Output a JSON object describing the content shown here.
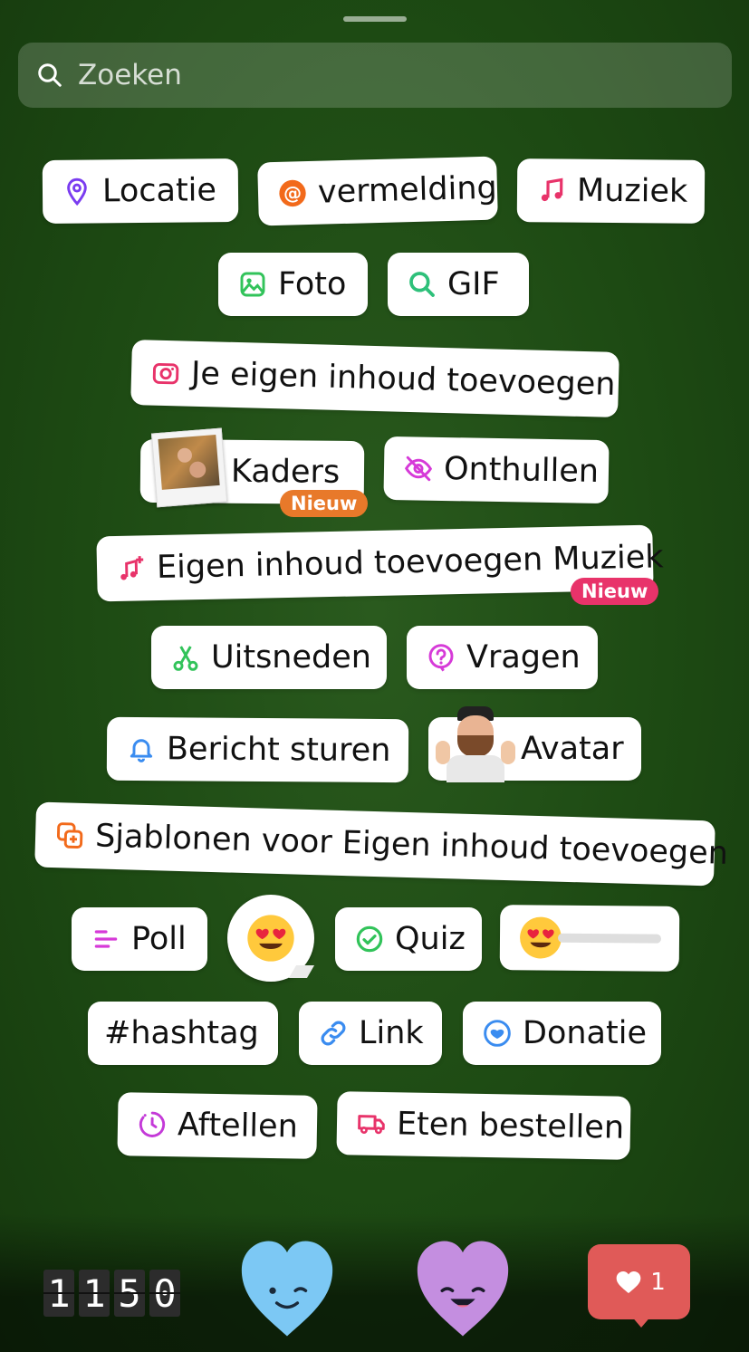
{
  "search": {
    "placeholder": "Zoeken"
  },
  "stickers": {
    "locatie": "Locatie",
    "vermelding": "vermelding",
    "muziek": "Muziek",
    "foto": "Foto",
    "gif": "GIF",
    "eigen_inhoud": "Je eigen inhoud toevoegen",
    "kaders": "Kaders",
    "kaders_badge": "Nieuw",
    "onthullen": "Onthullen",
    "eigen_muziek": "Eigen inhoud toevoegen Muziek",
    "eigen_muziek_badge": "Nieuw",
    "uitsneden": "Uitsneden",
    "vragen": "Vragen",
    "bericht": "Bericht sturen",
    "avatar": "Avatar",
    "sjablonen": "Sjablonen voor Eigen inhoud toevoegen",
    "poll": "Poll",
    "quiz": "Quiz",
    "hashtag": "#hashtag",
    "link": "Link",
    "donatie": "Donatie",
    "aftellen": "Aftellen",
    "eten": "Eten bestellen"
  },
  "counter": {
    "digits": [
      "1",
      "1",
      "5",
      "0"
    ]
  },
  "likes": {
    "count": "1"
  },
  "colors": {
    "background": "#1d4a13",
    "badge_orange": "#e8792a",
    "badge_pink": "#e8336a",
    "like_red": "#e05a58"
  }
}
